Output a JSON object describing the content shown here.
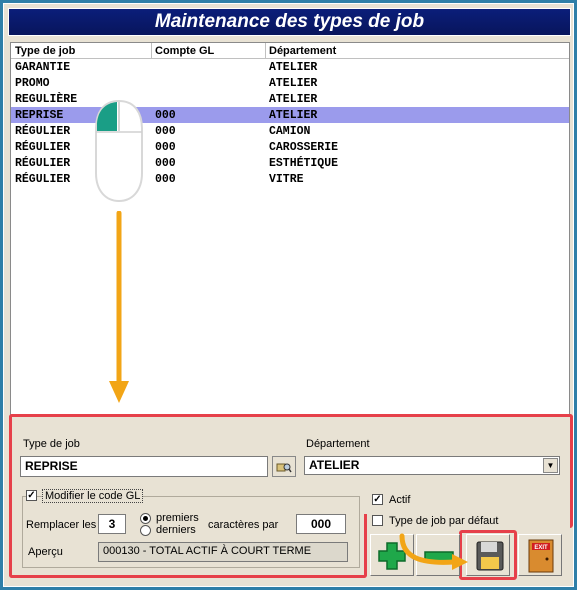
{
  "window": {
    "title": "Maintenance des types de job"
  },
  "list": {
    "columns": [
      "Type de job",
      "Compte GL",
      "Département"
    ],
    "rows": [
      {
        "type": "GARANTIE",
        "gl": "",
        "dept": "ATELIER"
      },
      {
        "type": "PROMO",
        "gl": "",
        "dept": "ATELIER"
      },
      {
        "type": "REGULIÈRE",
        "gl": "",
        "dept": "ATELIER"
      },
      {
        "type": "REPRISE",
        "gl": "000",
        "dept": "ATELIER",
        "selected": true
      },
      {
        "type": "RÉGULIER",
        "gl": "000",
        "dept": "CAMION"
      },
      {
        "type": "RÉGULIER",
        "gl": "000",
        "dept": "CAROSSERIE"
      },
      {
        "type": "RÉGULIER",
        "gl": "000",
        "dept": "ESTHÉTIQUE"
      },
      {
        "type": "RÉGULIER",
        "gl": "000",
        "dept": "VITRE"
      }
    ]
  },
  "form": {
    "type_label": "Type de job",
    "type_value": "REPRISE",
    "dept_label": "Département",
    "dept_value": "ATELIER",
    "modify_gl_label": "Modifier le code GL",
    "modify_gl_checked": true,
    "replace_label": "Remplacer les",
    "replace_count": "3",
    "radio_first": "premiers",
    "radio_last": "derniers",
    "chars_label": "caractères par",
    "chars_value": "000",
    "preview_label": "Aperçu",
    "preview_value": "000130 - TOTAL ACTIF À COURT TERME",
    "active_label": "Actif",
    "active_checked": true,
    "default_label": "Type de job par défaut",
    "default_checked": false
  },
  "toolbar": {
    "exit_label": "EXIT"
  },
  "icons": [
    "browse-icon",
    "mouse-icon",
    "add-icon",
    "remove-icon",
    "save-icon",
    "exit-icon"
  ],
  "colors": {
    "title_bg": "#0b1e7a",
    "selection": "#9b9bec",
    "highlight": "#e6404a",
    "arrow": "#f2a516"
  }
}
